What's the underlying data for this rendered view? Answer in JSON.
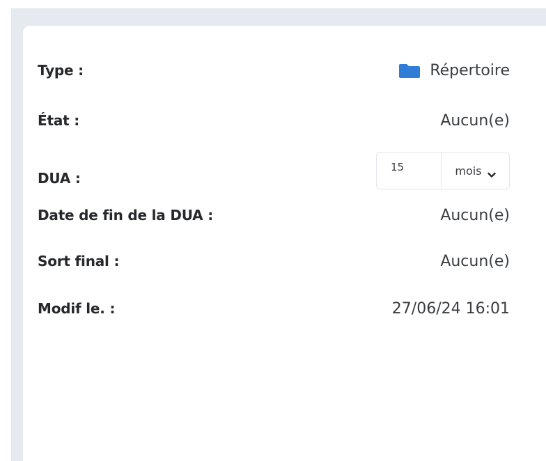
{
  "properties": {
    "type": {
      "label": "Type :",
      "value": "Répertoire",
      "icon": "folder-icon",
      "icon_color": "#2f7dd6"
    },
    "etat": {
      "label": "État :",
      "value": "Aucun(e)"
    },
    "dua": {
      "label": "DUA :",
      "input_value": "15",
      "unit_selected": "mois",
      "icon": "chevron-down-icon"
    },
    "date_fin_dua": {
      "label": "Date de fin de la DUA :",
      "value": "Aucun(e)"
    },
    "sort_final": {
      "label": "Sort final :",
      "value": "Aucun(e)"
    },
    "modif_le": {
      "label": "Modif le. :",
      "value": "27/06/24 16:01"
    }
  },
  "colors": {
    "background": "#e5eaf1",
    "panel": "#ffffff",
    "label_text": "#26282b",
    "value_text": "#3a3d40",
    "border": "#e2e5ea"
  }
}
